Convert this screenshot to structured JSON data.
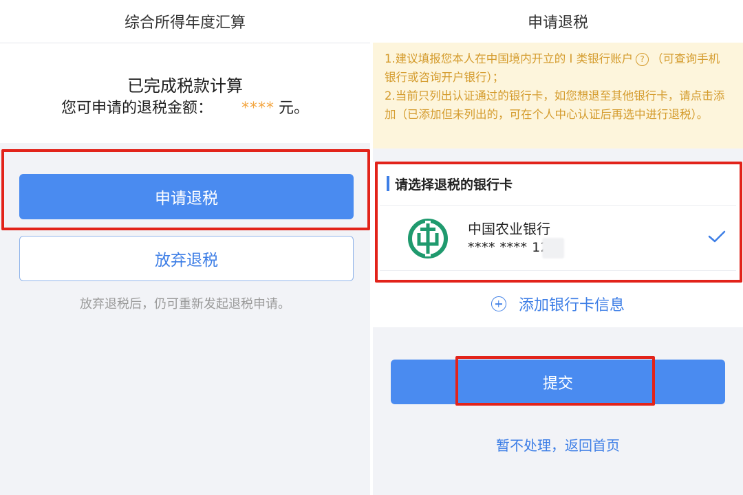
{
  "left": {
    "header_title": "综合所得年度汇算",
    "result_title": "已完成税款计算",
    "amount_label": "您可申请的退税金额：",
    "amount_value": "****",
    "amount_unit": "元。",
    "apply_button": "申请退税",
    "abandon_button": "放弃退税",
    "hint": "放弃退税后，仍可重新发起退税申请。"
  },
  "right": {
    "header_title": "申请退税",
    "notice_line1a": "1.建议填报您本人在中国境内开立的 I 类银行账户",
    "help_icon_glyph": "?",
    "notice_line1b": "（可查询手机银行或咨询开户银行）；",
    "notice_line2": "2.当前只列出认证通过的银行卡，如您想退至其他银行卡，请点击添加（已添加但未列出的，可在个人中心认证后再选中进行退税）。",
    "section_title": "请选择退税的银行卡",
    "bank_name": "中国农业银行",
    "card_number": "**** **** 12",
    "add_card": "添加银行卡信息",
    "submit_button": "提交",
    "back_link": "暂不处理，返回首页"
  },
  "colors": {
    "primary": "#4a8bf0",
    "link": "#3d7ee6",
    "highlight": "#e2231a",
    "notice_bg": "#fdf5dc",
    "notice_text": "#d49b2c",
    "bank_logo": "#1f9a6e",
    "amount_stars": "#f3a641"
  },
  "icons": {
    "help": "help-circle-icon",
    "bank": "abc-bank-logo-icon",
    "check": "check-icon",
    "add": "plus-circle-icon"
  }
}
